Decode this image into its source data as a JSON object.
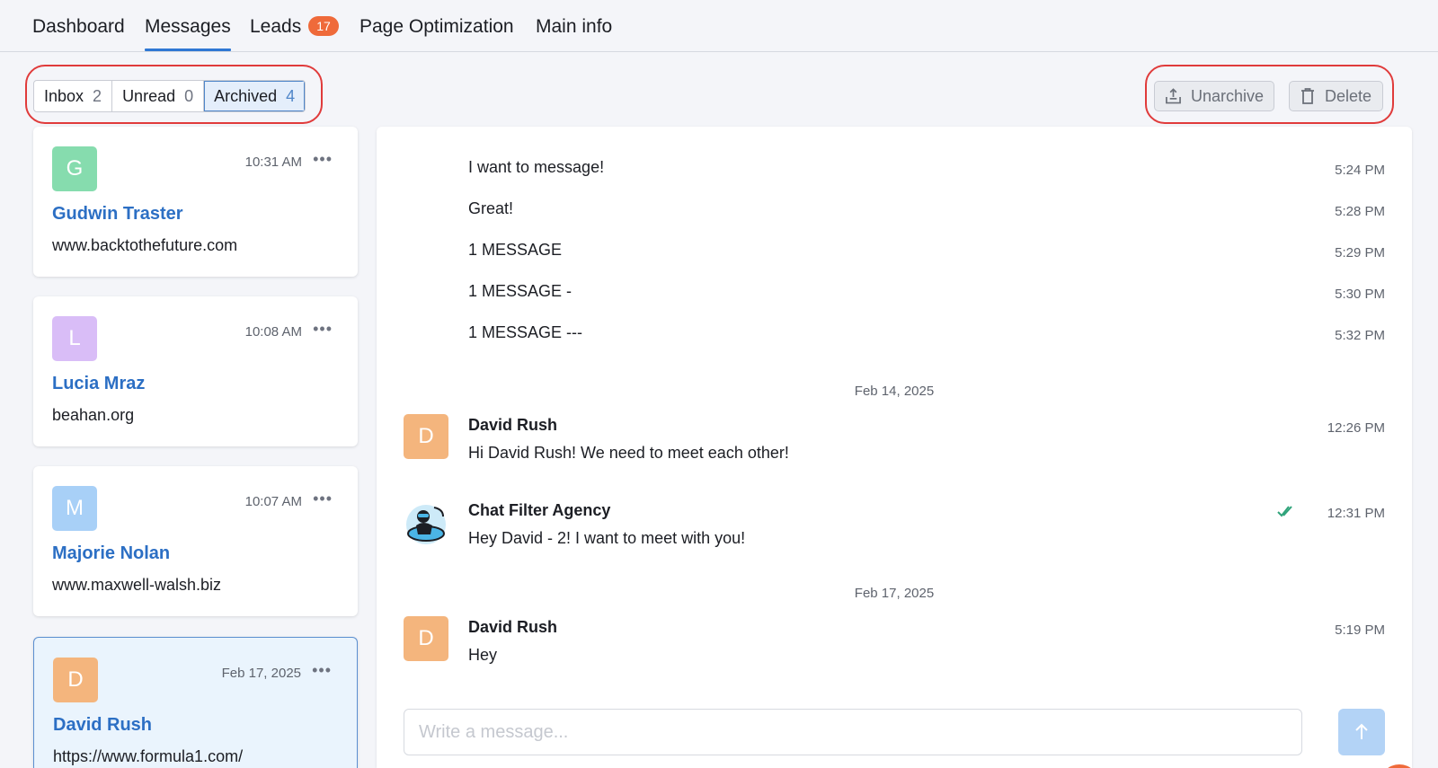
{
  "nav": {
    "tabs": [
      {
        "label": "Dashboard"
      },
      {
        "label": "Messages"
      },
      {
        "label": "Leads",
        "badge": "17"
      },
      {
        "label": "Page Optimization"
      },
      {
        "label": "Main info"
      }
    ],
    "active_tab": "Messages"
  },
  "filters": [
    {
      "label": "Inbox",
      "count": "2"
    },
    {
      "label": "Unread",
      "count": "0"
    },
    {
      "label": "Archived",
      "count": "4"
    }
  ],
  "active_filter": "Archived",
  "actions": {
    "unarchive_label": "Unarchive",
    "delete_label": "Delete",
    "unarchive_icon": "unarchive-icon",
    "delete_icon": "trash-icon"
  },
  "conversations": [
    {
      "initial": "G",
      "name": "Gudwin Traster",
      "site": "www.backtothefuture.com",
      "time": "10:31 AM",
      "color": "#86dcae"
    },
    {
      "initial": "L",
      "name": "Lucia Mraz",
      "site": "beahan.org",
      "time": "10:08 AM",
      "color": "#d9bdf7"
    },
    {
      "initial": "M",
      "name": "Majorie Nolan",
      "site": "www.maxwell-walsh.biz",
      "time": "10:07 AM",
      "color": "#a8d0f7"
    },
    {
      "initial": "D",
      "name": "David Rush",
      "site": "https://www.formula1.com/",
      "time": "Feb 17, 2025",
      "color": "#f4b57d",
      "selected": true
    }
  ],
  "chat": {
    "earlier_messages": [
      {
        "text": "I want to message!",
        "time": "5:24 PM"
      },
      {
        "text": "Great!",
        "time": "5:28 PM"
      },
      {
        "text": "1 MESSAGE",
        "time": "5:29 PM"
      },
      {
        "text": "1 MESSAGE -",
        "time": "5:30 PM"
      },
      {
        "text": "1 MESSAGE ---",
        "time": "5:32 PM"
      }
    ],
    "date1": "Feb 14, 2025",
    "msg1": {
      "initial": "D",
      "sender": "David Rush",
      "text": "Hi David Rush! We need to meet each other!",
      "time": "12:26 PM",
      "color": "#f4b57d"
    },
    "msg2": {
      "sender": "Chat Filter Agency",
      "text": "Hey David - 2! I want to meet with you!",
      "time": "12:31 PM",
      "status_icon": "double-check-icon"
    },
    "date2": "Feb 17, 2025",
    "msg3": {
      "initial": "D",
      "sender": "David Rush",
      "text": "Hey",
      "time": "5:19 PM",
      "color": "#f4b57d"
    },
    "composer_placeholder": "Write a message...",
    "send_icon": "arrow-up-icon"
  }
}
